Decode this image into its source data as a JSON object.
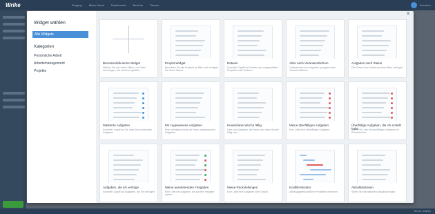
{
  "app": {
    "logo": "Wrike",
    "topnav": [
      "Eingang",
      "Meine Arbeit",
      "Dashboards",
      "Berichte",
      "Stream"
    ],
    "user": "Benutzer",
    "statusbar": "Neuer Ordner"
  },
  "dialog": {
    "title": "Widget wählen",
    "all_widgets": "Alle Widgets",
    "categories_title": "Kategorien",
    "categories": [
      "Persönliche Arbeit",
      "Arbeitsmanagement",
      "Projekte"
    ],
    "close_icon": "close-icon"
  },
  "widgets": [
    {
      "title": "Benutzerdefiniertes Widget",
      "desc": "Wählen Sie aus vielen Filtern, um Daten anzuzeigen, wie sie Ihnen gefallen",
      "icon": "plus-icon"
    },
    {
      "title": "Projekt-Widget",
      "desc": "Bewahren Sie alle Projekte im Blick und verfolgen Sie deren Status",
      "icon": "list-preview"
    },
    {
      "title": "Dateien",
      "desc": "Schneller Zugriff auf Dateien aus ausgewählten Projekten oder Ordnern",
      "icon": "list-preview"
    },
    {
      "title": "Aktiv nach Verantwortlichem",
      "desc": "Listenansicht von Aufgaben, gruppiert nach Verantwortlichem",
      "icon": "list-preview"
    },
    {
      "title": "Aufgaben nach Status",
      "desc": "Den Status Ihrer Arbeit auf einen Blick verfolgen",
      "icon": "list-preview"
    },
    {
      "title": "Markierte Aufgaben",
      "desc": "Schneller Zugriff auf die Liste Ihrer markierten Aufgaben",
      "icon": "star-list"
    },
    {
      "title": "Mir zugewiesene Aufgaben",
      "desc": "Eine sofortige Ansicht der Ihnen zugewiesenen Aufgaben",
      "icon": "list-preview"
    },
    {
      "title": "Heute/diese Woche fällig",
      "desc": "Liste von Aufgaben, die heute oder diese Woche fällig sind",
      "icon": "list-preview"
    },
    {
      "title": "Meine überfälligen Aufgaben",
      "desc": "Eine Liste Ihrer überfälligen Aufgaben",
      "icon": "calendar-list"
    },
    {
      "title": "Überfällige Aufgaben, die ich erstellt habe",
      "desc": "Sehen Sie, wer mit überfälligen Aufgaben im Rückstand ist",
      "icon": "calendar-list"
    },
    {
      "title": "Aufgaben, die ich verfolge",
      "desc": "Schneller Zugriff auf Aufgaben, die Sie verfolgen",
      "icon": "list-preview"
    },
    {
      "title": "Meine ausstehenden Freigaben",
      "desc": "Eine Liste der Aufgaben, die auf Ihre Freigabe warten",
      "icon": "approval-list"
    },
    {
      "title": "Meine Rückstellungen",
      "desc": "Eine Liste Ihrer Aufgaben ohne Datum",
      "icon": "list-preview"
    },
    {
      "title": "Konflikt-Monitor",
      "desc": "Abhängigkeitskonflikte in Projekten erkennen",
      "icon": "gantt-preview"
    },
    {
      "title": "Aktivitätsstream",
      "desc": "Sehen Sie die aktuellen Aktualisierungen",
      "icon": "list-preview"
    }
  ],
  "colors": {
    "accent": "#4a90d9",
    "star": "#4a90d9",
    "calendar": "#e05a5a",
    "approve": "#3aa855",
    "reject": "#e05a5a"
  }
}
